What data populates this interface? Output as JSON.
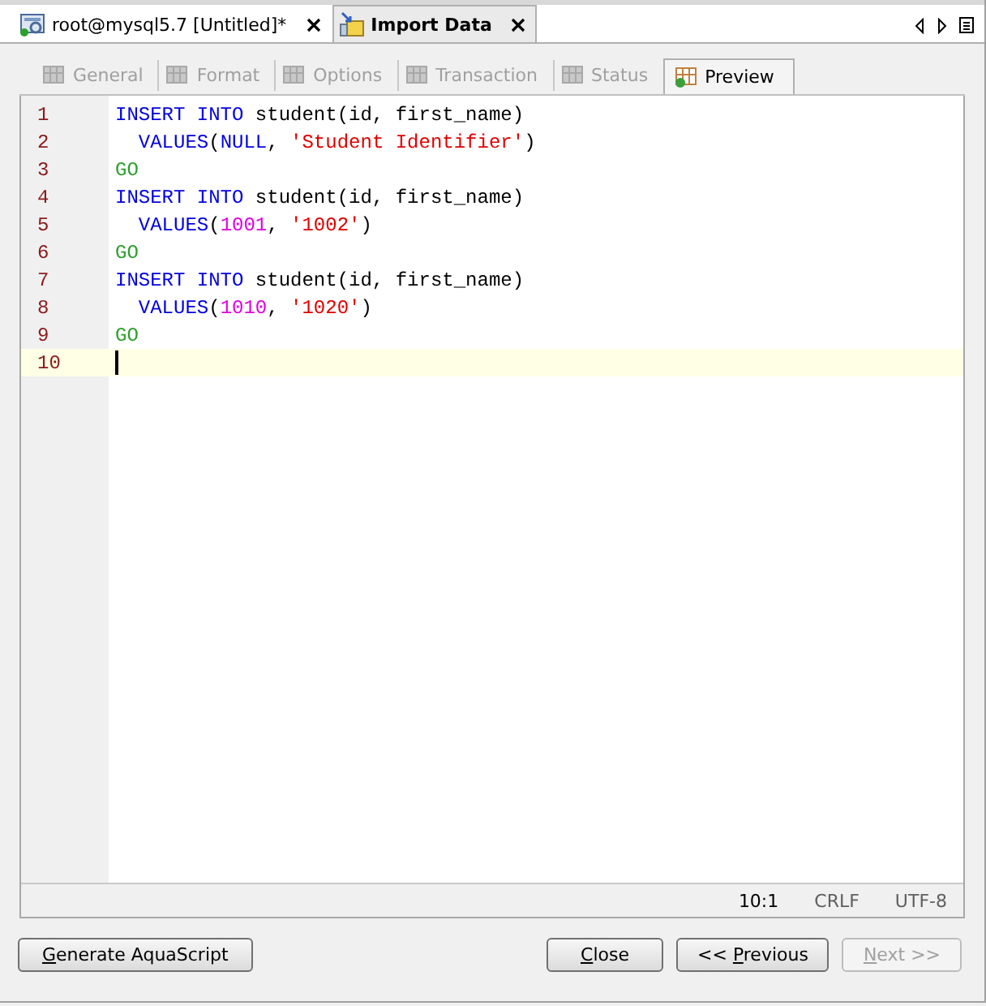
{
  "doc_tabs": [
    {
      "label": "root@mysql5.7 [Untitled]*",
      "selected": false
    },
    {
      "label": "Import Data",
      "selected": true
    }
  ],
  "wizard_tabs": [
    {
      "label": "General",
      "disabled": true,
      "selected": false
    },
    {
      "label": "Format",
      "disabled": true,
      "selected": false
    },
    {
      "label": "Options",
      "disabled": true,
      "selected": false
    },
    {
      "label": "Transaction",
      "disabled": true,
      "selected": false
    },
    {
      "label": "Status",
      "disabled": true,
      "selected": false
    },
    {
      "label": "Preview",
      "disabled": false,
      "selected": true
    }
  ],
  "editor": {
    "lines": [
      {
        "number": "1",
        "current": false,
        "tokens": [
          {
            "kind": "keyword",
            "text": "INSERT INTO"
          },
          {
            "kind": "plain",
            "text": " student(id, first_name)"
          }
        ]
      },
      {
        "number": "2",
        "current": false,
        "tokens": [
          {
            "kind": "keyword",
            "text": "  VALUES"
          },
          {
            "kind": "plain",
            "text": "("
          },
          {
            "kind": "keyword",
            "text": "NULL"
          },
          {
            "kind": "plain",
            "text": ", "
          },
          {
            "kind": "string",
            "text": "'Student Identifier'"
          },
          {
            "kind": "plain",
            "text": ")"
          }
        ]
      },
      {
        "number": "3",
        "current": false,
        "tokens": [
          {
            "kind": "go",
            "text": "GO"
          }
        ]
      },
      {
        "number": "4",
        "current": false,
        "tokens": [
          {
            "kind": "keyword",
            "text": "INSERT INTO"
          },
          {
            "kind": "plain",
            "text": " student(id, first_name)"
          }
        ]
      },
      {
        "number": "5",
        "current": false,
        "tokens": [
          {
            "kind": "keyword",
            "text": "  VALUES"
          },
          {
            "kind": "plain",
            "text": "("
          },
          {
            "kind": "number",
            "text": "1001"
          },
          {
            "kind": "plain",
            "text": ", "
          },
          {
            "kind": "string",
            "text": "'1002'"
          },
          {
            "kind": "plain",
            "text": ")"
          }
        ]
      },
      {
        "number": "6",
        "current": false,
        "tokens": [
          {
            "kind": "go",
            "text": "GO"
          }
        ]
      },
      {
        "number": "7",
        "current": false,
        "tokens": [
          {
            "kind": "keyword",
            "text": "INSERT INTO"
          },
          {
            "kind": "plain",
            "text": " student(id, first_name)"
          }
        ]
      },
      {
        "number": "8",
        "current": false,
        "tokens": [
          {
            "kind": "keyword",
            "text": "  VALUES"
          },
          {
            "kind": "plain",
            "text": "("
          },
          {
            "kind": "number",
            "text": "1010"
          },
          {
            "kind": "plain",
            "text": ", "
          },
          {
            "kind": "string",
            "text": "'1020'"
          },
          {
            "kind": "plain",
            "text": ")"
          }
        ]
      },
      {
        "number": "9",
        "current": false,
        "tokens": [
          {
            "kind": "go",
            "text": "GO"
          }
        ]
      },
      {
        "number": "10",
        "current": true
      }
    ]
  },
  "status_bar": {
    "position": "10:1",
    "line_ending": "CRLF",
    "encoding": "UTF-8"
  },
  "left_buttons": [
    {
      "mnemonic": "G",
      "rest": "enerate AquaScript",
      "disabled": false
    }
  ],
  "right_buttons": [
    {
      "mnemonic": "C",
      "rest": "lose",
      "disabled": false
    },
    {
      "prefix": "<< ",
      "mnemonic": "P",
      "rest": "revious",
      "disabled": false
    },
    {
      "mnemonic": "N",
      "rest": "ext >>",
      "disabled": true
    }
  ]
}
